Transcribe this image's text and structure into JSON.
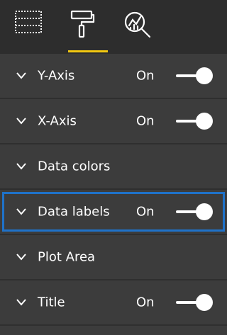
{
  "toolbar": {
    "tools": [
      {
        "icon": "fields-icon"
      },
      {
        "icon": "format-paint-roller-icon",
        "active": true
      },
      {
        "icon": "analytics-magnifier-icon"
      }
    ],
    "active_underline_color": "#f2c811"
  },
  "sections": [
    {
      "label": "Y-Axis",
      "state": "On",
      "has_toggle": true
    },
    {
      "label": "X-Axis",
      "state": "On",
      "has_toggle": true
    },
    {
      "label": "Data colors",
      "has_toggle": false
    },
    {
      "label": "Data labels",
      "state": "On",
      "has_toggle": true,
      "highlighted": true
    },
    {
      "label": "Plot Area",
      "has_toggle": false
    },
    {
      "label": "Title",
      "state": "On",
      "has_toggle": true
    }
  ],
  "colors": {
    "background": "#3c3c3c",
    "toolbar": "#2d2d2d",
    "highlight_border": "#1f72c9",
    "text": "#ffffff"
  }
}
